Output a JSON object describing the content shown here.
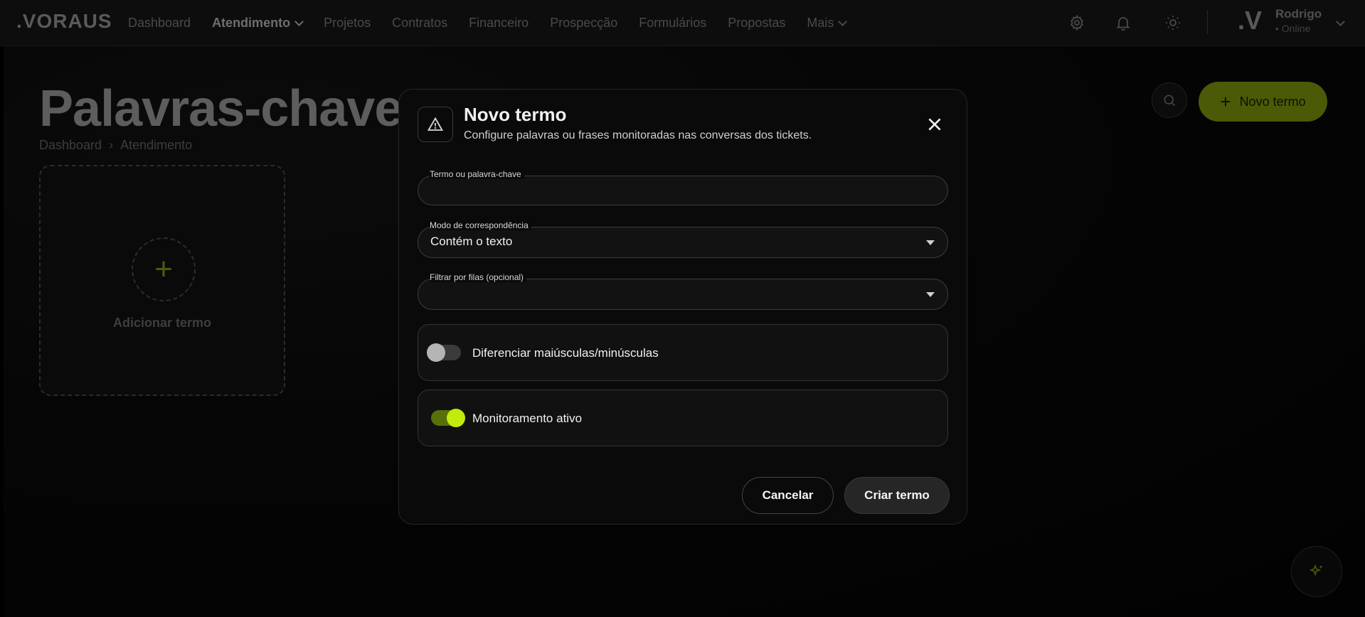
{
  "brand": {
    "name": ".VORAUS"
  },
  "nav": {
    "items": [
      {
        "label": "Dashboard"
      },
      {
        "label": "Atendimento",
        "active": true,
        "has_dropdown": true
      },
      {
        "label": "Projetos"
      },
      {
        "label": "Contratos"
      },
      {
        "label": "Financeiro"
      },
      {
        "label": "Prospecção"
      },
      {
        "label": "Formulários"
      },
      {
        "label": "Propostas"
      },
      {
        "label": "Mais",
        "has_dropdown": true
      }
    ]
  },
  "header_icons": [
    "gear-icon",
    "bell-icon",
    "sun-icon"
  ],
  "user": {
    "avatar": ".V",
    "name": "Rodrigo",
    "status": "• Online"
  },
  "page": {
    "title": "Palavras-chave",
    "breadcrumb": [
      "Dashboard",
      "Atendimento"
    ],
    "breadcrumb_separator": "›",
    "new_button": "Novo termo",
    "add_card_label": "Adicionar termo"
  },
  "modal": {
    "title": "Novo termo",
    "subtitle": "Configure palavras ou frases monitoradas nas conversas dos tickets.",
    "fields": {
      "term": {
        "label": "Termo ou palavra-chave",
        "value": "",
        "placeholder": ""
      },
      "match_mode": {
        "label": "Modo de correspondência",
        "value": "Contém o texto"
      },
      "queue_filter": {
        "label": "Filtrar por filas (opcional)",
        "value": ""
      }
    },
    "toggles": {
      "case_sensitive": {
        "label": "Diferenciar maiúsculas/minúsculas",
        "on": false
      },
      "active_monitoring": {
        "label": "Monitoramento ativo",
        "on": true
      }
    },
    "buttons": {
      "cancel": "Cancelar",
      "create": "Criar termo"
    }
  },
  "colors": {
    "accent": "#c2ea0c",
    "accent_dim": "#4b5a06",
    "background": "#000000",
    "modal_bg": "#0a0a0a"
  }
}
